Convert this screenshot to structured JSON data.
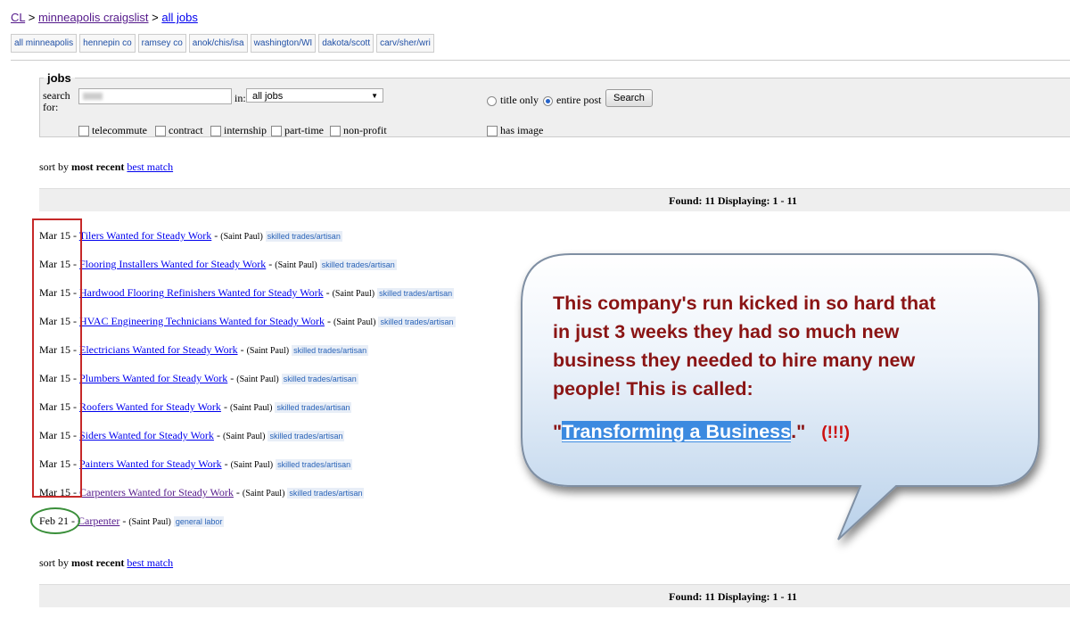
{
  "breadcrumb": {
    "cl": "CL",
    "sep1": " > ",
    "city": "minneapolis craigslist",
    "sep2": " > ",
    "section": "all jobs"
  },
  "areas": [
    "all minneapolis",
    "hennepin co",
    "ramsey co",
    "anok/chis/isa",
    "washington/WI",
    "dakota/scott",
    "carv/sher/wri"
  ],
  "search": {
    "legend": "jobs",
    "label": "search for:",
    "in_label": "in:",
    "category": "all jobs",
    "title_only": "title only",
    "entire_post": "entire post",
    "button": "Search",
    "filters": [
      "telecommute",
      "contract",
      "internship",
      "part-time",
      "non-profit"
    ],
    "has_image": "has image"
  },
  "sort": {
    "prefix": "sort by",
    "current": "most recent",
    "alt": "best match"
  },
  "found": "Found: 11 Displaying: 1 - 11",
  "listings": [
    {
      "date": "Mar 15",
      "title": "Tilers Wanted for Steady Work",
      "loc": "(Saint Paul)",
      "cat": "skilled trades/artisan"
    },
    {
      "date": "Mar 15",
      "title": "Flooring Installers Wanted for Steady Work",
      "loc": "(Saint Paul)",
      "cat": "skilled trades/artisan"
    },
    {
      "date": "Mar 15",
      "title": "Hardwood Flooring Refinishers Wanted for Steady Work",
      "loc": "(Saint Paul)",
      "cat": "skilled trades/artisan"
    },
    {
      "date": "Mar 15",
      "title": "HVAC Engineering Technicians Wanted for Steady Work",
      "loc": "(Saint Paul)",
      "cat": "skilled trades/artisan"
    },
    {
      "date": "Mar 15",
      "title": "Electricians Wanted for Steady Work",
      "loc": "(Saint Paul)",
      "cat": "skilled trades/artisan"
    },
    {
      "date": "Mar 15",
      "title": "Plumbers Wanted for Steady Work",
      "loc": "(Saint Paul)",
      "cat": "skilled trades/artisan"
    },
    {
      "date": "Mar 15",
      "title": "Roofers Wanted for Steady Work",
      "loc": "(Saint Paul)",
      "cat": "skilled trades/artisan"
    },
    {
      "date": "Mar 15",
      "title": "Siders Wanted for Steady Work",
      "loc": "(Saint Paul)",
      "cat": "skilled trades/artisan"
    },
    {
      "date": "Mar 15",
      "title": "Painters Wanted for Steady Work",
      "loc": "(Saint Paul)",
      "cat": "skilled trades/artisan"
    },
    {
      "date": "Mar 15",
      "title": "Carpenters Wanted for Steady Work",
      "loc": "(Saint Paul)",
      "cat": "skilled trades/artisan"
    },
    {
      "date": "Feb 21",
      "title": "Carpenter",
      "loc": "(Saint Paul)",
      "cat": "general labor"
    }
  ],
  "callout": {
    "line1": "This company's run kicked in so hard that",
    "line2": "in just 3 weeks they had so much new",
    "line3": "business they needed to hire many new",
    "line4": "people! This is called:",
    "quote_open": "\"",
    "highlight": "Transforming a Business",
    "quote_close": ".\"",
    "exclaim": "(!!!)"
  },
  "colors": {
    "annotation_red": "#c62828",
    "annotation_green": "#3a8f3a",
    "callout_text": "#8a1414",
    "link": "#0000ee"
  }
}
